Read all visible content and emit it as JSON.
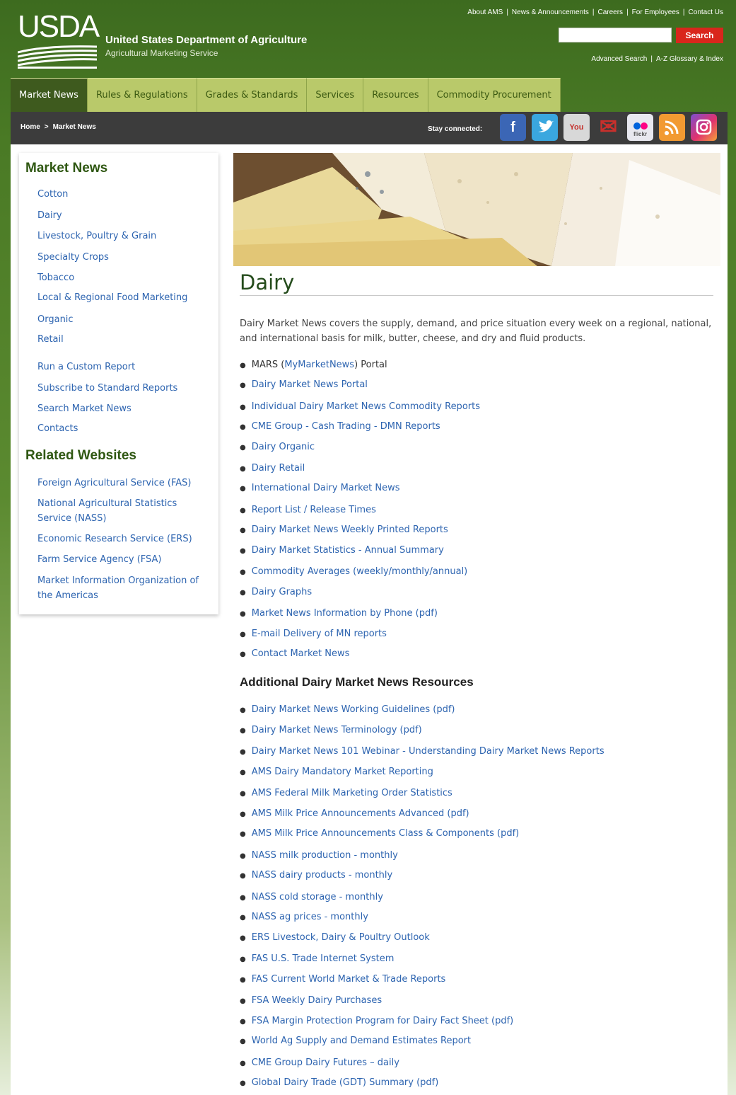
{
  "header": {
    "logo_text": "USDA",
    "org_name": "United States Department of Agriculture",
    "org_sub": "Agricultural Marketing Service",
    "top_links": [
      "About AMS",
      "News & Announcements",
      "Careers",
      "For Employees",
      "Contact Us"
    ],
    "search_placeholder": "",
    "search_button": "Search",
    "sub_links": [
      "Advanced Search",
      "A-Z Glossary & Index"
    ]
  },
  "nav": {
    "tabs": [
      "Market News",
      "Rules & Regulations",
      "Grades & Standards",
      "Services",
      "Resources",
      "Commodity Procurement"
    ]
  },
  "breadcrumb": {
    "home": "Home",
    "arrow": ">",
    "current": "Market News",
    "stay_connected": "Stay connected:"
  },
  "social": {
    "icons": [
      "facebook-icon",
      "twitter-icon",
      "youtube-icon",
      "email-icon",
      "flickr-icon",
      "rss-icon",
      "instagram-icon"
    ],
    "facebook": "f",
    "youtube": "You Tube",
    "email": "✉",
    "flickr": "flickr",
    "rss": "◉",
    "instagram": "◎"
  },
  "sidebar": {
    "heading": "Market News",
    "items": [
      "Cotton",
      "Dairy",
      "Livestock, Poultry & Grain",
      "Specialty Crops",
      "Tobacco",
      "Local & Regional Food Marketing",
      "Organic",
      "Retail"
    ],
    "tools": [
      "Run a Custom Report",
      "Subscribe to Standard Reports",
      "Search Market News",
      "Contacts"
    ],
    "related_heading": "Related Websites",
    "related": [
      "Foreign Agricultural Service (FAS)",
      "National Agricultural Statistics Service (NASS)",
      "Economic Research Service (ERS)",
      "Farm Service Agency (FSA)",
      "Market Information Organization of the Americas"
    ]
  },
  "main": {
    "title": "Dairy",
    "intro": "Dairy Market News covers the supply, demand, and price situation every week on a regional, national, and international basis for milk, butter, cheese, and dry and fluid products.",
    "mars_pre": "MARS (",
    "mars_link": "MyMarketNews",
    "mars_post": ") Portal",
    "links": [
      "Dairy Market News Portal",
      "Individual Dairy Market News Commodity Reports",
      "CME Group - Cash Trading - DMN Reports",
      "Dairy Organic",
      "Dairy Retail",
      "International Dairy Market News",
      "Report List / Release Times",
      "Dairy Market News Weekly Printed Reports",
      "Dairy Market Statistics - Annual Summary",
      "Commodity Averages (weekly/monthly/annual)",
      "Dairy Graphs",
      "Market News Information by Phone (pdf)",
      "E-mail Delivery of MN reports",
      "Contact Market News"
    ],
    "resources_heading": "Additional Dairy Market News Resources",
    "resources": [
      "Dairy Market News Working Guidelines (pdf)",
      "Dairy Market News Terminology (pdf)",
      "Dairy Market News 101 Webinar - Understanding Dairy Market News Reports",
      "AMS Dairy Mandatory Market Reporting",
      "AMS Federal Milk Marketing Order Statistics",
      "AMS Milk Price Announcements Advanced (pdf)",
      "AMS Milk Price Announcements Class & Components (pdf)",
      "NASS milk production - monthly",
      "NASS dairy products - monthly",
      "NASS cold storage - monthly",
      "NASS ag prices - monthly",
      "ERS Livestock, Dairy & Poultry Outlook",
      "FAS U.S. Trade Internet System",
      "FAS Current World Market & Trade Reports",
      "FSA Weekly Dairy Purchases",
      "FSA Margin Protection Program for Dairy Fact Sheet (pdf)",
      "World Ag Supply and Demand Estimates Report",
      "CME Group Dairy Futures – daily",
      "Global Dairy Trade (GDT) Summary (pdf)"
    ]
  }
}
